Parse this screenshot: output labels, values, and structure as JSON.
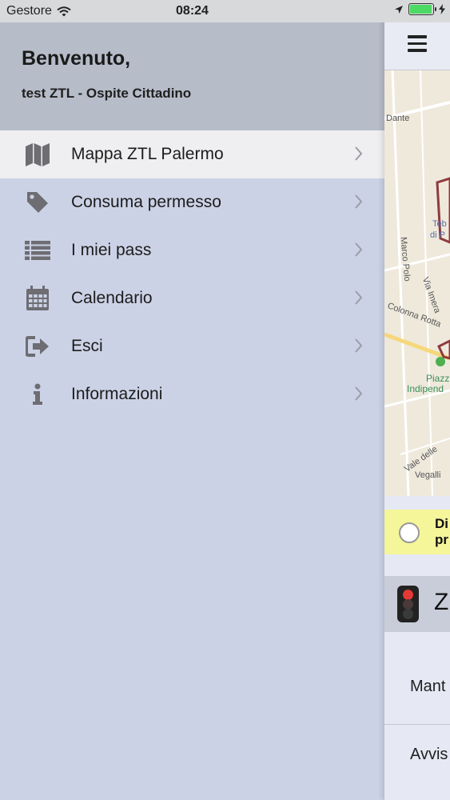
{
  "status_bar": {
    "carrier": "Gestore",
    "time": "08:24"
  },
  "drawer": {
    "welcome": "Benvenuto,",
    "user": "test ZTL - Ospite Cittadino",
    "items": [
      {
        "label": "Mappa ZTL Palermo",
        "icon": "map-icon",
        "active": true
      },
      {
        "label": "Consuma permesso",
        "icon": "tag-icon",
        "active": false
      },
      {
        "label": "I miei pass",
        "icon": "list-icon",
        "active": false
      },
      {
        "label": "Calendario",
        "icon": "calendar-icon",
        "active": false
      },
      {
        "label": "Esci",
        "icon": "sign-out-icon",
        "active": false
      },
      {
        "label": "Informazioni",
        "icon": "info-icon",
        "active": false
      }
    ]
  },
  "main": {
    "map_labels": [
      "Dante",
      "Teb",
      "di P",
      "Marco Polo",
      "Via Imera",
      "Colonna Rotta",
      "Piazz",
      "Indipend",
      "Vale delle",
      "Vegalli"
    ],
    "banner": {
      "line1": "Di",
      "line2": "pr"
    },
    "ztl_header": "Z",
    "settings": [
      "Mant",
      "Avvis"
    ]
  },
  "colors": {
    "drawer_bg": "#ccd2e6",
    "header_bg": "#b7bcc9",
    "active_row": "#efeff1",
    "banner_bg": "#f5f59a",
    "battery": "#4cd964",
    "ztl_zone": "#8e3b3e"
  }
}
